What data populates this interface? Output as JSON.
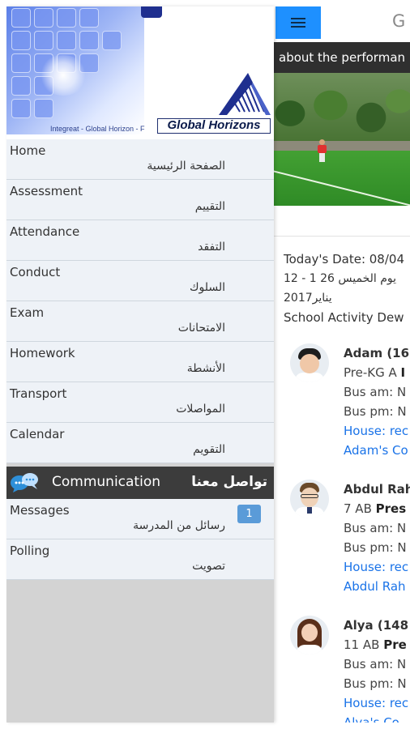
{
  "topbar": {
    "letter": "G"
  },
  "banner": {
    "text": "about the performan"
  },
  "today": {
    "line1": "Today's Date: 08/04",
    "line2": "12 - 1 يوم الخميس 26",
    "line3": "يناير2017",
    "line4": "School Activity Dew"
  },
  "students": [
    {
      "name": "Adam (16",
      "class_prefix": "Pre-KG A",
      "class_bold": "I",
      "bus_am": "Bus am: N",
      "bus_pm": "Bus pm: N",
      "house": "House: rec",
      "link": "Adam's Co"
    },
    {
      "name": "Abdul Rah",
      "class_prefix": "7 AB",
      "class_bold": "Pres",
      "bus_am": "Bus am: N",
      "bus_pm": "Bus pm: N",
      "house": "House: rec",
      "link": "Abdul Rah"
    },
    {
      "name": "Alya (148",
      "class_prefix": "11 AB",
      "class_bold": "Pre",
      "bus_am": "Bus am: N",
      "bus_pm": "Bus pm: N",
      "house": "House: rec",
      "link": "Alya's Co"
    }
  ],
  "drawer": {
    "tagline": "Integreat - Global Horizon - F",
    "logo_text": "Global Horizons",
    "nav": [
      {
        "en": "Home",
        "ar": "الصفحة الرئيسية"
      },
      {
        "en": "Assessment",
        "ar": "التقييم"
      },
      {
        "en": "Attendance",
        "ar": "التفقد"
      },
      {
        "en": "Conduct",
        "ar": "السلوك"
      },
      {
        "en": "Exam",
        "ar": "الامتحانات"
      },
      {
        "en": "Homework",
        "ar": "الأنشطة"
      },
      {
        "en": "Transport",
        "ar": "المواصلات"
      },
      {
        "en": "Calendar",
        "ar": "التقويم"
      }
    ],
    "communication": {
      "en": "Communication",
      "ar": "تواصل معنا"
    },
    "comm_items": [
      {
        "en": "Messages",
        "ar": "رسائل من المدرسة",
        "badge": "1"
      },
      {
        "en": "Polling",
        "ar": "تصويت"
      }
    ]
  },
  "colors": {
    "accent": "#1e90ff",
    "drawer_bg": "#d3d3d3",
    "nav_bg": "#eef2f7",
    "comm_bg": "#3c3c3c",
    "link": "#1a73e8",
    "badge": "#5a9bd8"
  }
}
